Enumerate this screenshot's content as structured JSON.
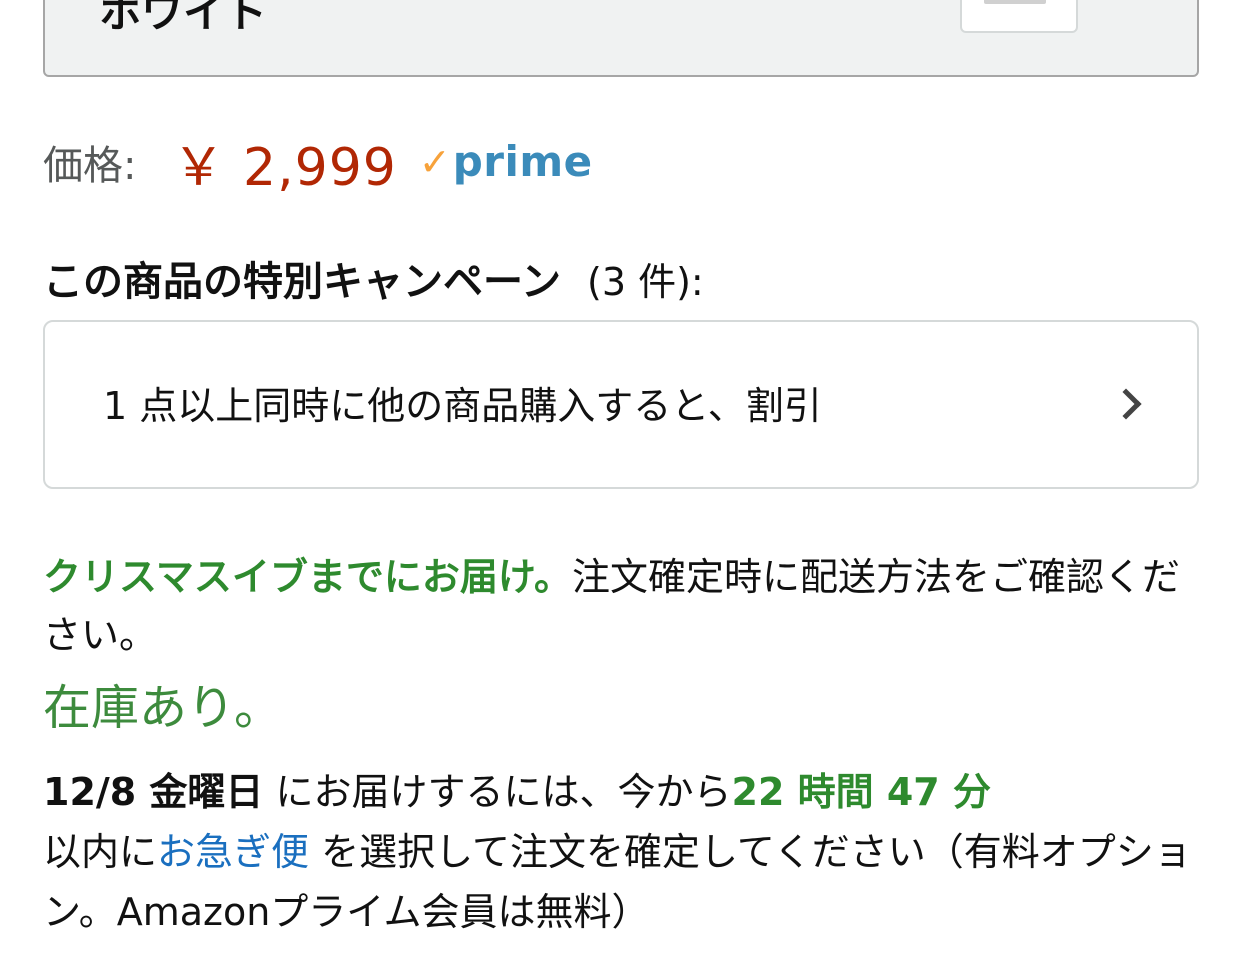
{
  "variant": {
    "label": "ホワイト"
  },
  "price": {
    "label": "価格:",
    "value": "￥ 2,999",
    "prime_check": "✓",
    "prime_text": "prime"
  },
  "campaign": {
    "title": "この商品の特別キャンペーン",
    "count": "(3 件):",
    "item_text": "1 点以上同時に他の商品購入すると、割引"
  },
  "delivery_note": {
    "highlight": "クリスマスイブまでにお届け。",
    "text": "注文確定時に配送方法をご確認ください。"
  },
  "stock": "在庫あり。",
  "delivery_info": {
    "date": "12/8 金曜日",
    "text1": " にお届けするには、今から",
    "countdown": "22 時間 47 分",
    "text2": "以内に",
    "link": "お急ぎ便",
    "text3": " を選択して注文を確定してください（有料オプション。Amazonプライム会員は無料）"
  },
  "colors": {
    "price": "#b12704",
    "green": "#2e8a2e",
    "link": "#1a6fbf",
    "prime_blue": "#3b8bba",
    "prime_check": "#f7a23b"
  },
  "icons": {
    "campaign_arrow": "chevron-right-icon",
    "prime": "prime-check-icon"
  }
}
